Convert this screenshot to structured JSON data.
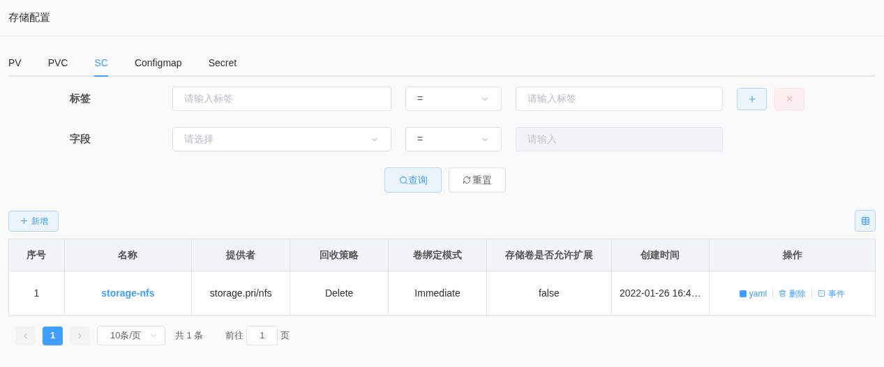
{
  "page_title": "存储配置",
  "tabs": [
    {
      "label": "PV",
      "selected": false
    },
    {
      "label": "PVC",
      "selected": false
    },
    {
      "label": "SC",
      "selected": true
    },
    {
      "label": "Configmap",
      "selected": false
    },
    {
      "label": "Secret",
      "selected": false
    }
  ],
  "filters": [
    {
      "label": "标签",
      "key": {
        "kind": "input",
        "placeholder": "请输入标签",
        "disabled": false
      },
      "operator": "=",
      "value": {
        "placeholder": "请输入标签",
        "disabled": false
      },
      "actions": [
        {
          "kind": "add",
          "disabled": false
        },
        {
          "kind": "remove",
          "disabled": true
        }
      ]
    },
    {
      "label": "字段",
      "key": {
        "kind": "select",
        "placeholder": "请选择",
        "disabled": false
      },
      "operator": "=",
      "value": {
        "placeholder": "请输入",
        "disabled": true
      }
    }
  ],
  "search_button": "查询",
  "reset_button": "重置",
  "add_button": "新增",
  "table": {
    "columns": [
      "序号",
      "名称",
      "提供者",
      "回收策略",
      "卷绑定模式",
      "存储卷是否允许扩展",
      "创建时间",
      "操作"
    ],
    "rows": [
      {
        "index": "1",
        "name": "storage-nfs",
        "provisioner": "storage.pri/nfs",
        "reclaim": "Delete",
        "binding": "Immediate",
        "expand": "false",
        "created": "2022-01-26 16:4…",
        "actions": [
          {
            "kind": "yaml",
            "label": "yaml"
          },
          {
            "kind": "delete",
            "label": "删除"
          },
          {
            "kind": "events",
            "label": "事件"
          }
        ]
      }
    ]
  },
  "pagination": {
    "pages": [
      {
        "label": "1",
        "selected": true
      }
    ],
    "page_size": "10条/页",
    "total": "共 1 条",
    "goto_label": "前往",
    "goto_value": "1",
    "goto_suffix": "页"
  }
}
